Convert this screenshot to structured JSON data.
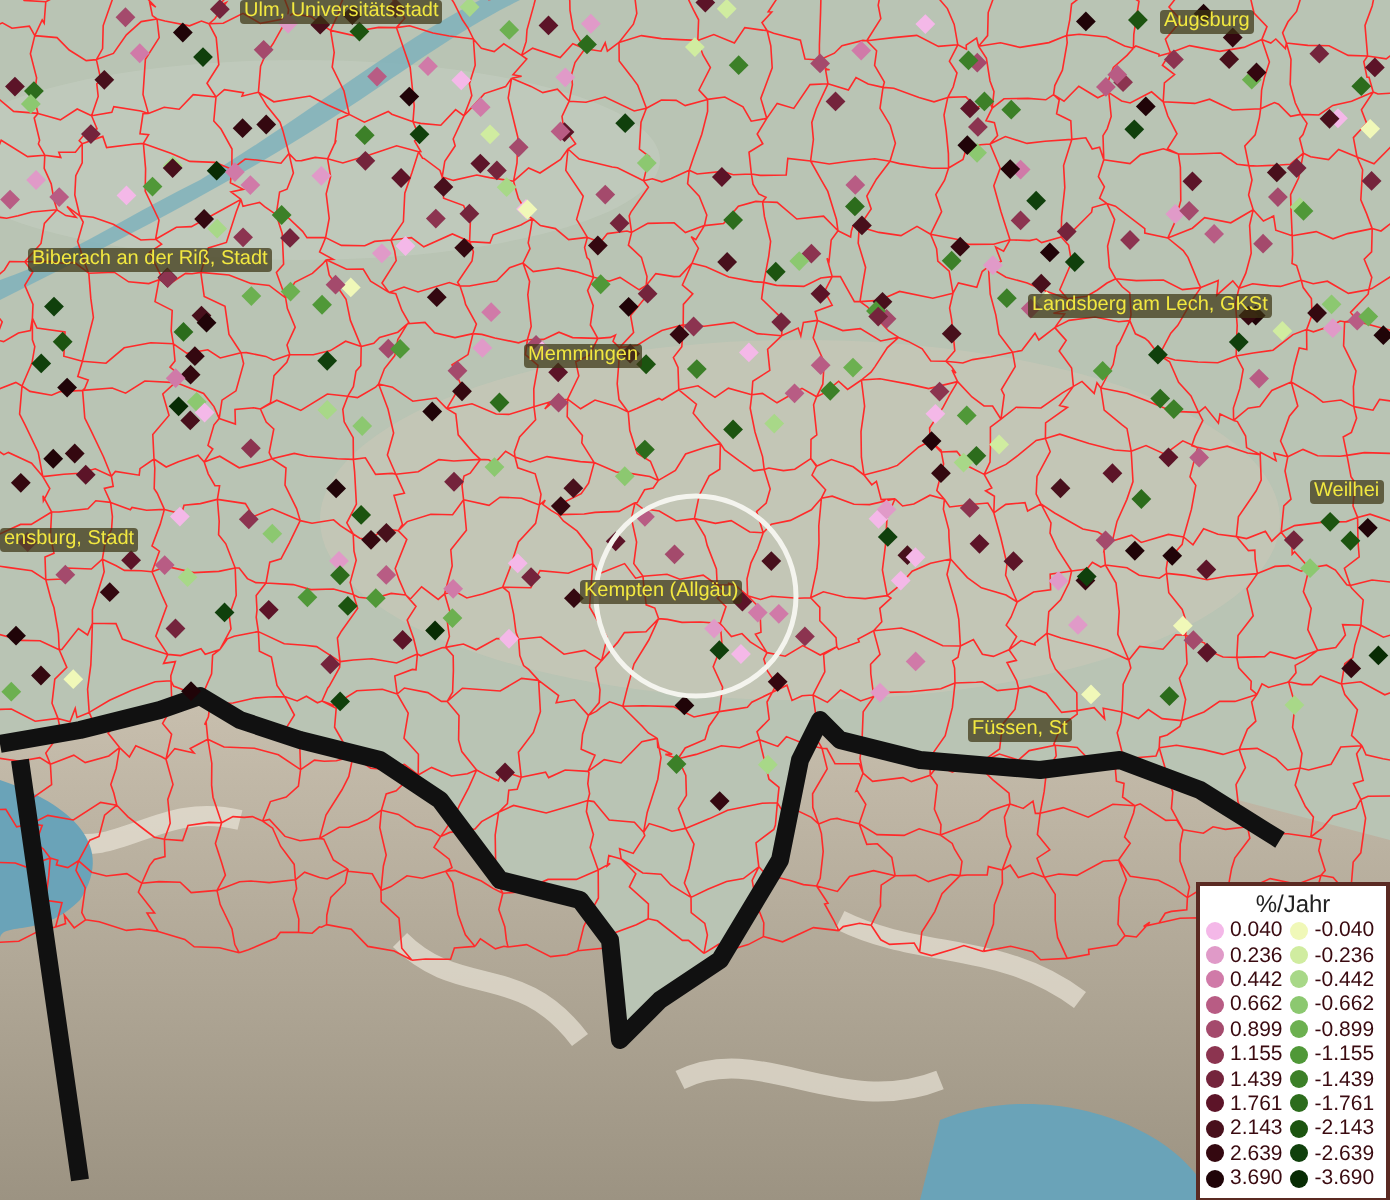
{
  "map": {
    "labels": [
      {
        "text": "Ulm, Universitätsstadt"
      },
      {
        "text": "Augsburg"
      },
      {
        "text": "Biberach an der Riß, Stadt"
      },
      {
        "text": "Landsberg am Lech, GKSt"
      },
      {
        "text": "Memmingen"
      },
      {
        "text": "Weilhei"
      },
      {
        "text": "ensburg, Stadt"
      },
      {
        "text": "Kempten (Allgäu)"
      },
      {
        "text": "Füssen, St"
      }
    ]
  },
  "legend": {
    "title": "%/Jahr",
    "positive": [
      {
        "label": "0.040",
        "color": "#f4b8e8"
      },
      {
        "label": "0.236",
        "color": "#e09ac8"
      },
      {
        "label": "0.442",
        "color": "#d07aa8"
      },
      {
        "label": "0.662",
        "color": "#b85c84"
      },
      {
        "label": "0.899",
        "color": "#a44a6c"
      },
      {
        "label": "1.155",
        "color": "#8c3450"
      },
      {
        "label": "1.439",
        "color": "#74243c"
      },
      {
        "label": "1.761",
        "color": "#5c1428"
      },
      {
        "label": "2.143",
        "color": "#48101c"
      },
      {
        "label": "2.639",
        "color": "#340810"
      },
      {
        "label": "3.690",
        "color": "#200408"
      }
    ],
    "negative": [
      {
        "label": "-0.040",
        "color": "#f0f8b8"
      },
      {
        "label": "-0.236",
        "color": "#d0eca0"
      },
      {
        "label": "-0.442",
        "color": "#a8d888"
      },
      {
        "label": "-0.662",
        "color": "#8cc870"
      },
      {
        "label": "-0.899",
        "color": "#6cb050"
      },
      {
        "label": "-1.155",
        "color": "#509838"
      },
      {
        "label": "-1.439",
        "color": "#3c8028"
      },
      {
        "label": "-1.761",
        "color": "#2c6c1c"
      },
      {
        "label": "-2.143",
        "color": "#1c5410"
      },
      {
        "label": "-2.639",
        "color": "#10400c"
      },
      {
        "label": "-3.690",
        "color": "#082c04"
      }
    ]
  }
}
